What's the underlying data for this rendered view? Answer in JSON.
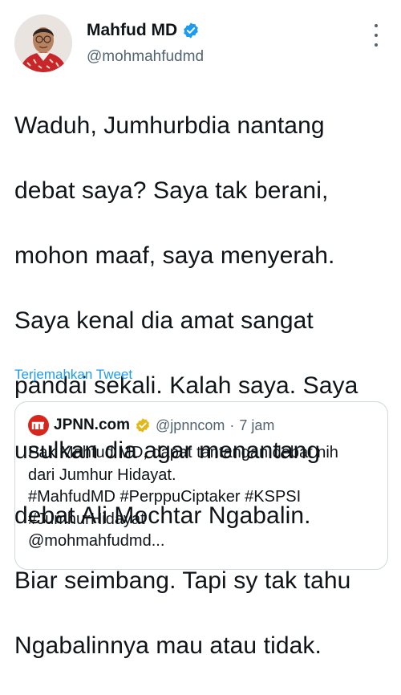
{
  "author": {
    "name": "Mahfud MD",
    "handle": "@mohmahfudmd"
  },
  "tweet": {
    "lines": [
      "Waduh, Jumhurbdia nantang",
      "debat saya? Saya tak berani,",
      "mohon maaf, saya menyerah.",
      "Saya kenal dia amat sangat",
      "pandai sekali. Kalah saya. Saya",
      "usulkan dia agar menantang",
      "debat Ali Mochtar Ngabalin.",
      "Biar seimbang. Tapi sy tak tahu",
      "Ngabalinnya mau atau tidak."
    ],
    "translate_label": "Terjemahkan Tweet"
  },
  "quote": {
    "name": "JPNN.com",
    "handle": "@jpnncom",
    "separator": "·",
    "time": "7 jam",
    "lines": [
      "Pak Mahfud MD, dapat tantangan debat nih",
      "dari Jumhur Hidayat.",
      "#MahfudMD #PerppuCiptaker #KSPSI",
      "#JumhurHidayat",
      "@mohmahfudmd..."
    ]
  },
  "colors": {
    "text": "#0f1419",
    "secondary": "#536471",
    "link": "#1d9bf0",
    "verified_blue": "#1d9bf0",
    "verified_gold": "#e2b719",
    "jpnn_red": "#d9261c"
  },
  "icons": {
    "verified": "verified-badge-icon",
    "more": "more-options-icon",
    "jpnn_logo": "jpnn-logo-icon"
  }
}
